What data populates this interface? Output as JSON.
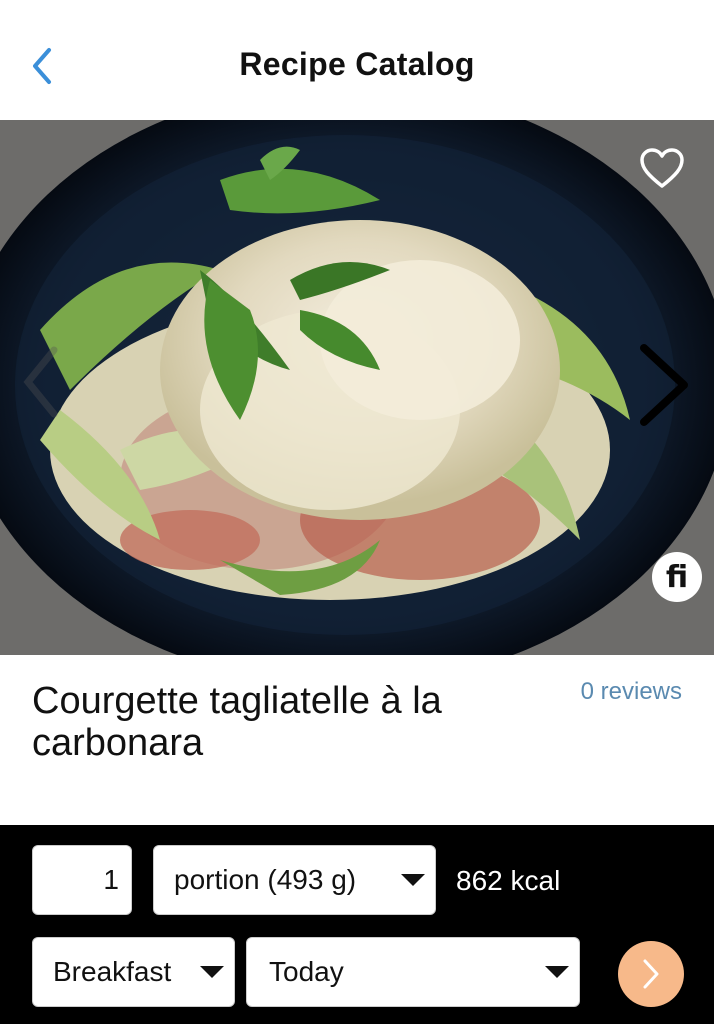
{
  "header": {
    "title": "Recipe Catalog",
    "back_icon": "chevron-left-icon",
    "accent_color": "#3b8fd9"
  },
  "hero": {
    "favorite_icon": "heart-outline-icon",
    "prev_icon": "chevron-left-icon",
    "next_icon": "chevron-right-icon",
    "badge_text": "fi"
  },
  "recipe": {
    "title": "Courgette tagliatelle à la carbonara",
    "reviews": "0 reviews",
    "reviews_color": "#5a8ab0"
  },
  "log": {
    "quantity": "1",
    "portion": "portion (493 g)",
    "kcal": "862 kcal",
    "meal": "Breakfast",
    "day": "Today",
    "go_icon": "chevron-right-icon",
    "go_color": "#f7b98a"
  }
}
